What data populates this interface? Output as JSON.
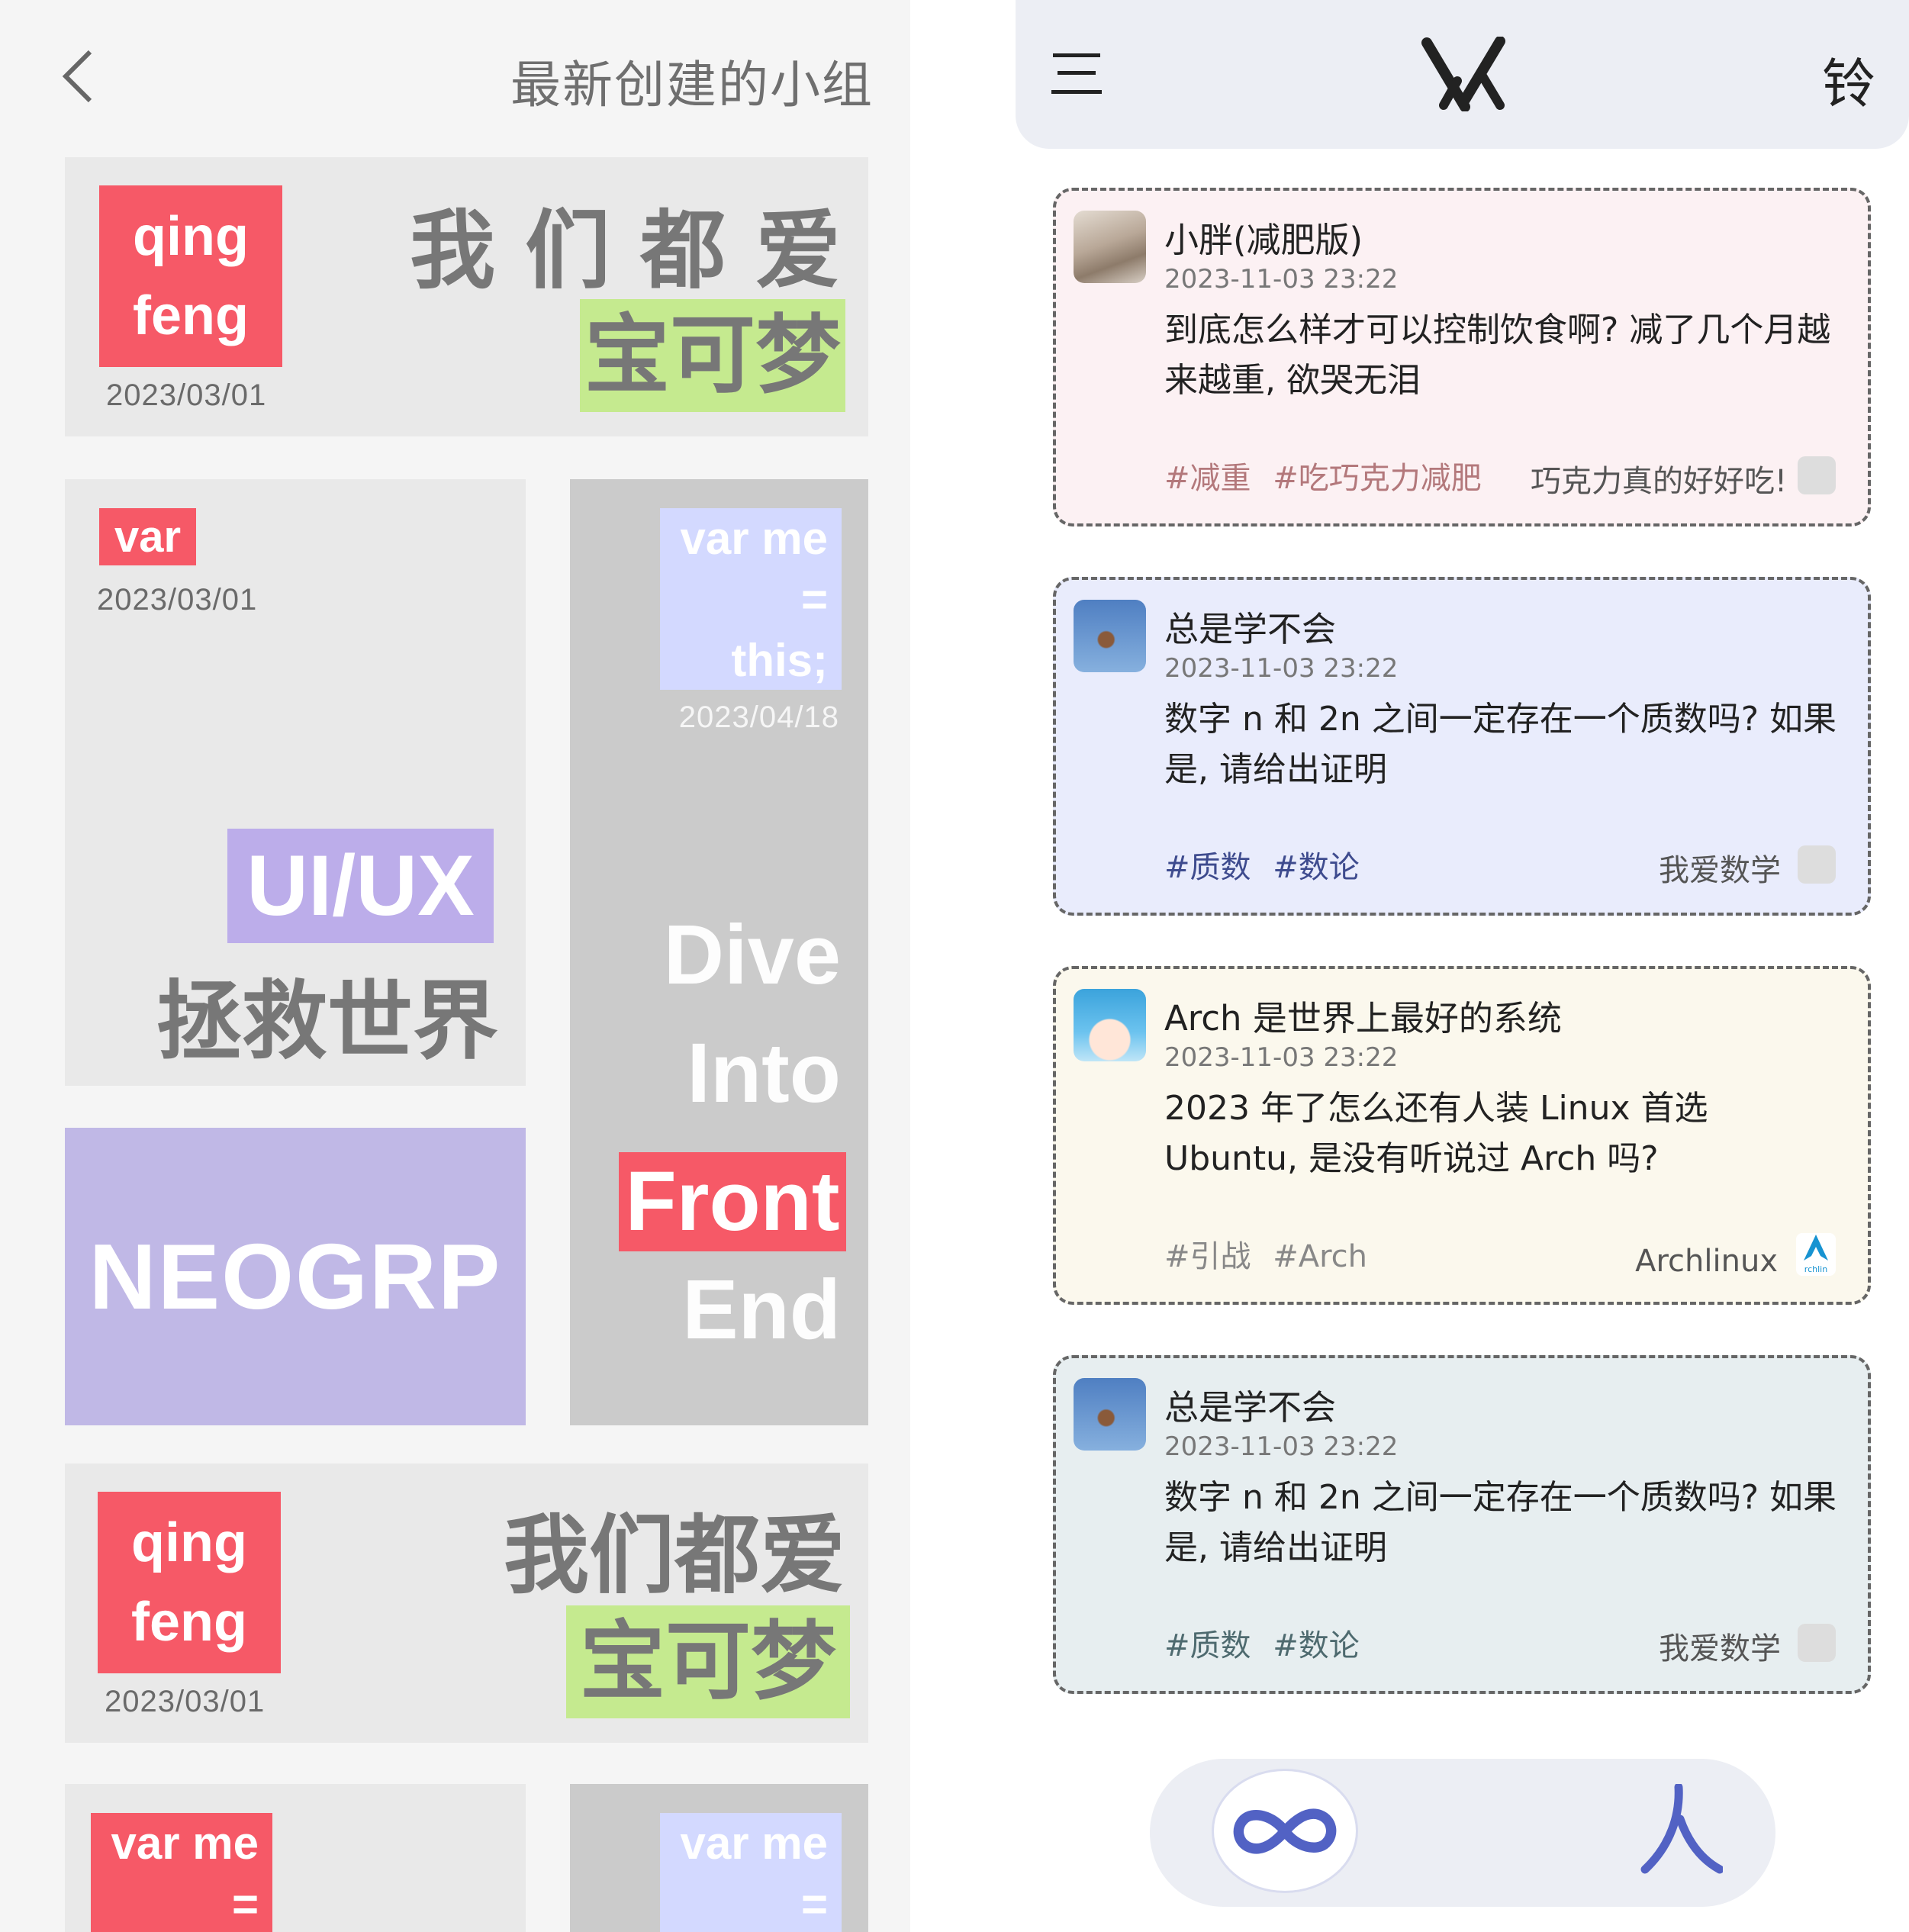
{
  "left": {
    "title": "最新创建的小组",
    "cards": {
      "qingfeng1": {
        "tag_line1": "qing",
        "tag_line2": "feng",
        "date": "2023/03/01",
        "title": "我 们 都 爱",
        "highlight": "宝可梦"
      },
      "var": {
        "tag": "var",
        "date": "2023/03/01",
        "title1": "UI/UX",
        "title2": "拯救世界"
      },
      "varme": {
        "tag_line1": "var me",
        "tag_line2": "=",
        "tag_line3": "this;",
        "date": "2023/04/18",
        "line1": "Dive",
        "line2": "Into",
        "line3": "Front",
        "line4": "End"
      },
      "neogrp": {
        "title": "NEOGRP"
      },
      "qingfeng2": {
        "tag_line1": "qing",
        "tag_line2": "feng",
        "date": "2023/03/01",
        "title": "我们都爱",
        "highlight": "宝可梦"
      },
      "varme2": {
        "tag_line1": "var me",
        "tag_line2": "="
      },
      "varme3": {
        "tag_line1": "var me",
        "tag_line2": "="
      }
    }
  },
  "header": {
    "menu_icon": "menu-icon",
    "logo_icon": "logo-icon",
    "bell_text": "铃"
  },
  "posts": [
    {
      "author": "小胖(减肥版)",
      "time": "2023-11-03 23:22",
      "text": "到底怎么样才可以控制饮食啊? 减了几个月越来越重, 欲哭无泪",
      "tags": [
        "#减重",
        "#吃巧克力减肥"
      ],
      "group": "巧克力真的好好吃!",
      "bg": "#fcf1f3",
      "tag_color": "#b3787b"
    },
    {
      "author": "总是学不会",
      "time": "2023-11-03 23:22",
      "text": "数字 n 和 2n 之间一定存在一个质数吗? 如果是, 请给出证明",
      "tags": [
        "#质数",
        "#数论"
      ],
      "group": "我爱数学",
      "bg": "#e9ecfc",
      "tag_color": "#3e4b8e"
    },
    {
      "author": "Arch 是世界上最好的系统",
      "time": "2023-11-03 23:22",
      "text": "2023 年了怎么还有人装 Linux 首选 Ubuntu, 是没有听说过 Arch 吗?",
      "tags": [
        "#引战",
        "#Arch"
      ],
      "group": "Archlinux",
      "group_icon_text": "rchlin",
      "bg": "#fbf8ed",
      "tag_color": "#888888"
    },
    {
      "author": "总是学不会",
      "time": "2023-11-03 23:22",
      "text": "数字 n 和 2n 之间一定存在一个质数吗? 如果是, 请给出证明",
      "tags": [
        "#质数",
        "#数论"
      ],
      "group": "我爱数学",
      "bg": "#e7eef0",
      "tag_color": "#4e6a6f"
    }
  ],
  "bottom_nav": {
    "items": [
      "infinity-icon",
      "person-icon"
    ]
  }
}
